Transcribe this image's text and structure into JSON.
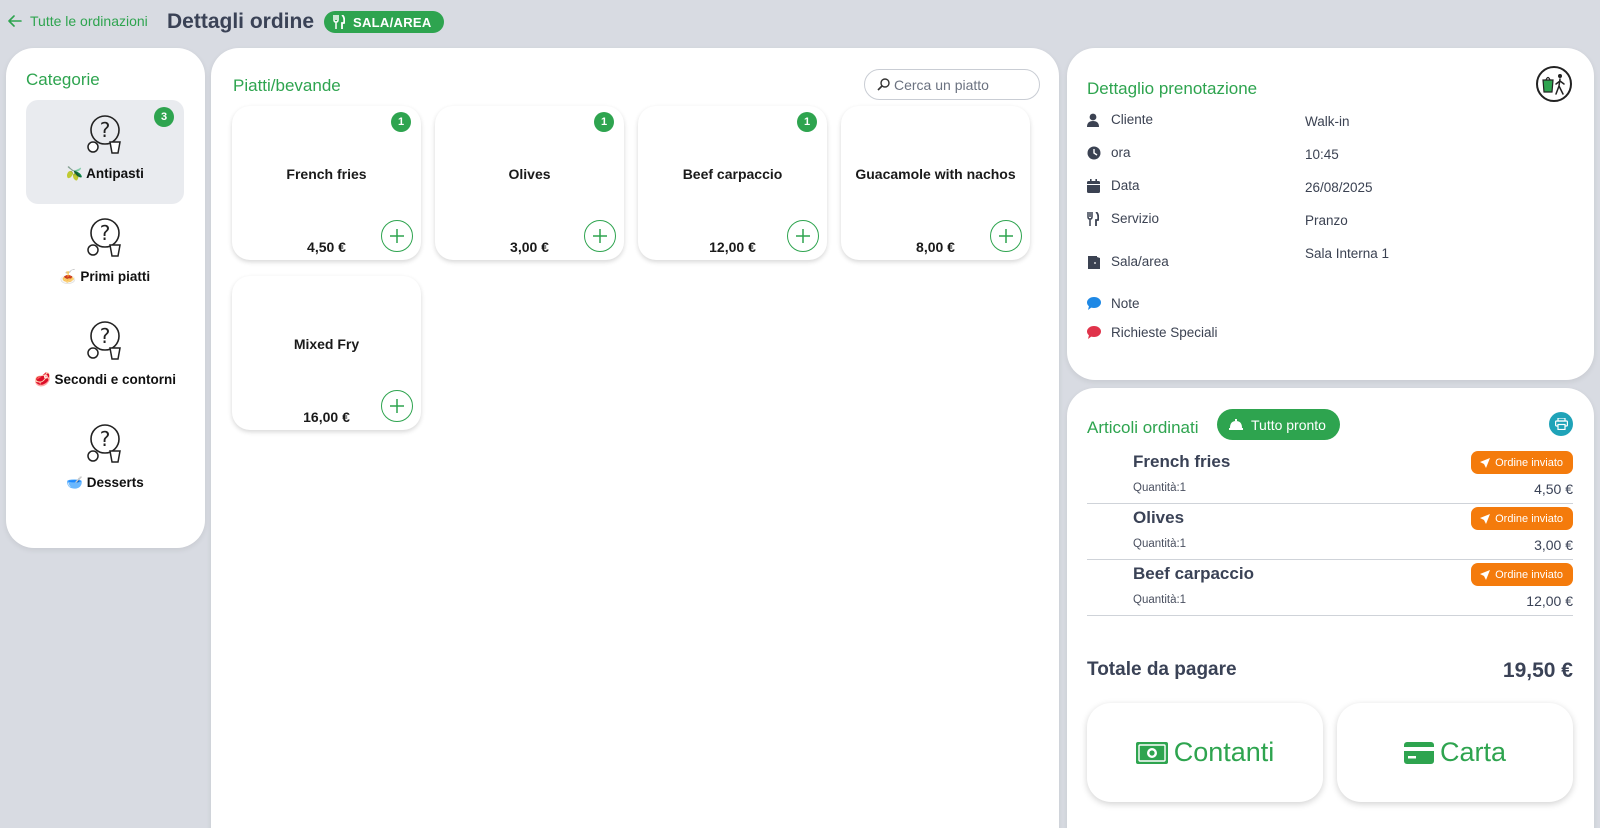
{
  "header": {
    "back_label": "Tutte le ordinazioni",
    "title": "Dettagli ordine",
    "area_badge": "SALA/AREA"
  },
  "categories": {
    "title": "Categorie",
    "items": [
      {
        "label": "🫒 Antipasti",
        "count": "3",
        "active": true
      },
      {
        "label": "🍝 Primi piatti"
      },
      {
        "label": "🥩 Secondi e contorni"
      },
      {
        "label": "🥣 Desserts"
      }
    ]
  },
  "dishes": {
    "title": "Piatti/bevande",
    "search_placeholder": "Cerca un piatto",
    "items": [
      {
        "name": "French fries",
        "price": "4,50 €",
        "count": "1"
      },
      {
        "name": "Olives",
        "price": "3,00 €",
        "count": "1"
      },
      {
        "name": "Beef carpaccio",
        "price": "12,00 €",
        "count": "1"
      },
      {
        "name": "Guacamole with nachos",
        "price": "8,00 €"
      },
      {
        "name": "Mixed Fry",
        "price": "16,00 €"
      }
    ]
  },
  "booking": {
    "title": "Dettaglio prenotazione",
    "rows": [
      {
        "icon": "user-icon",
        "label": "Cliente",
        "value": "Walk-in"
      },
      {
        "icon": "clock-icon",
        "label": "ora",
        "value": "10:45"
      },
      {
        "icon": "calendar-icon",
        "label": "Data",
        "value": "26/08/2025"
      },
      {
        "icon": "utensils-icon",
        "label": "Servizio",
        "value": "Pranzo"
      },
      {
        "icon": "door-icon",
        "label": "Sala/area",
        "value": "Sala Interna 1"
      },
      {
        "icon": "note-bubble-icon",
        "label": "Note",
        "value": ""
      },
      {
        "icon": "special-request-bubble-icon",
        "label": "Richieste Speciali",
        "value": ""
      }
    ]
  },
  "order": {
    "title": "Articoli ordinati",
    "ready_label": "Tutto pronto",
    "items": [
      {
        "name": "French fries",
        "qty": "Quantità:1",
        "status": "Ordine inviato",
        "price": "4,50 €"
      },
      {
        "name": "Olives",
        "qty": "Quantità:1",
        "status": "Ordine inviato",
        "price": "3,00 €"
      },
      {
        "name": "Beef carpaccio",
        "qty": "Quantità:1",
        "status": "Ordine inviato",
        "price": "12,00 €"
      }
    ],
    "total_label": "Totale da pagare",
    "total_value": "19,50 €",
    "pay_cash_label": "Contanti",
    "pay_card_label": "Carta"
  },
  "colors": {
    "accent": "#2ea44f",
    "status_sent": "#f47b0c",
    "print": "#1fa3b8",
    "background": "#d8dbe2"
  }
}
